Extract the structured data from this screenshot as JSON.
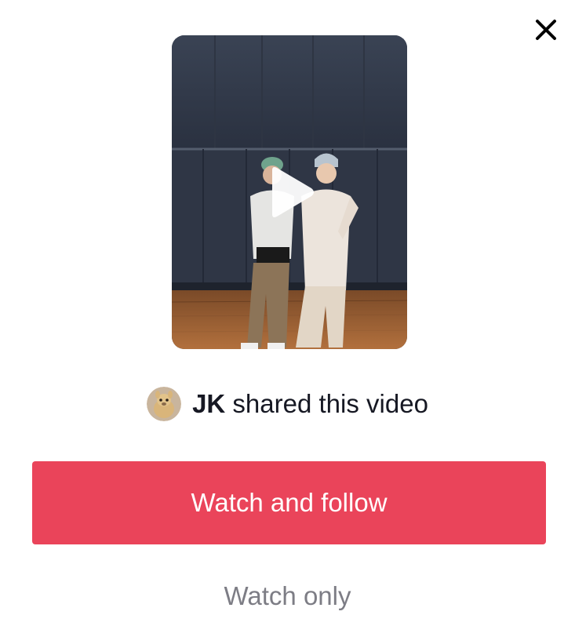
{
  "dialog": {
    "close_icon": "close-icon",
    "video": {
      "thumbnail_description": "two dancers posing in a dance studio",
      "play_icon": "play-icon"
    },
    "share": {
      "avatar_icon": "avatar-icon",
      "username": "JK",
      "text": " shared this video"
    },
    "primary_action": "Watch and follow",
    "secondary_action": "Watch only",
    "colors": {
      "primary": "#ea445a",
      "secondary_text": "#7d7d85",
      "text": "#161823"
    }
  }
}
